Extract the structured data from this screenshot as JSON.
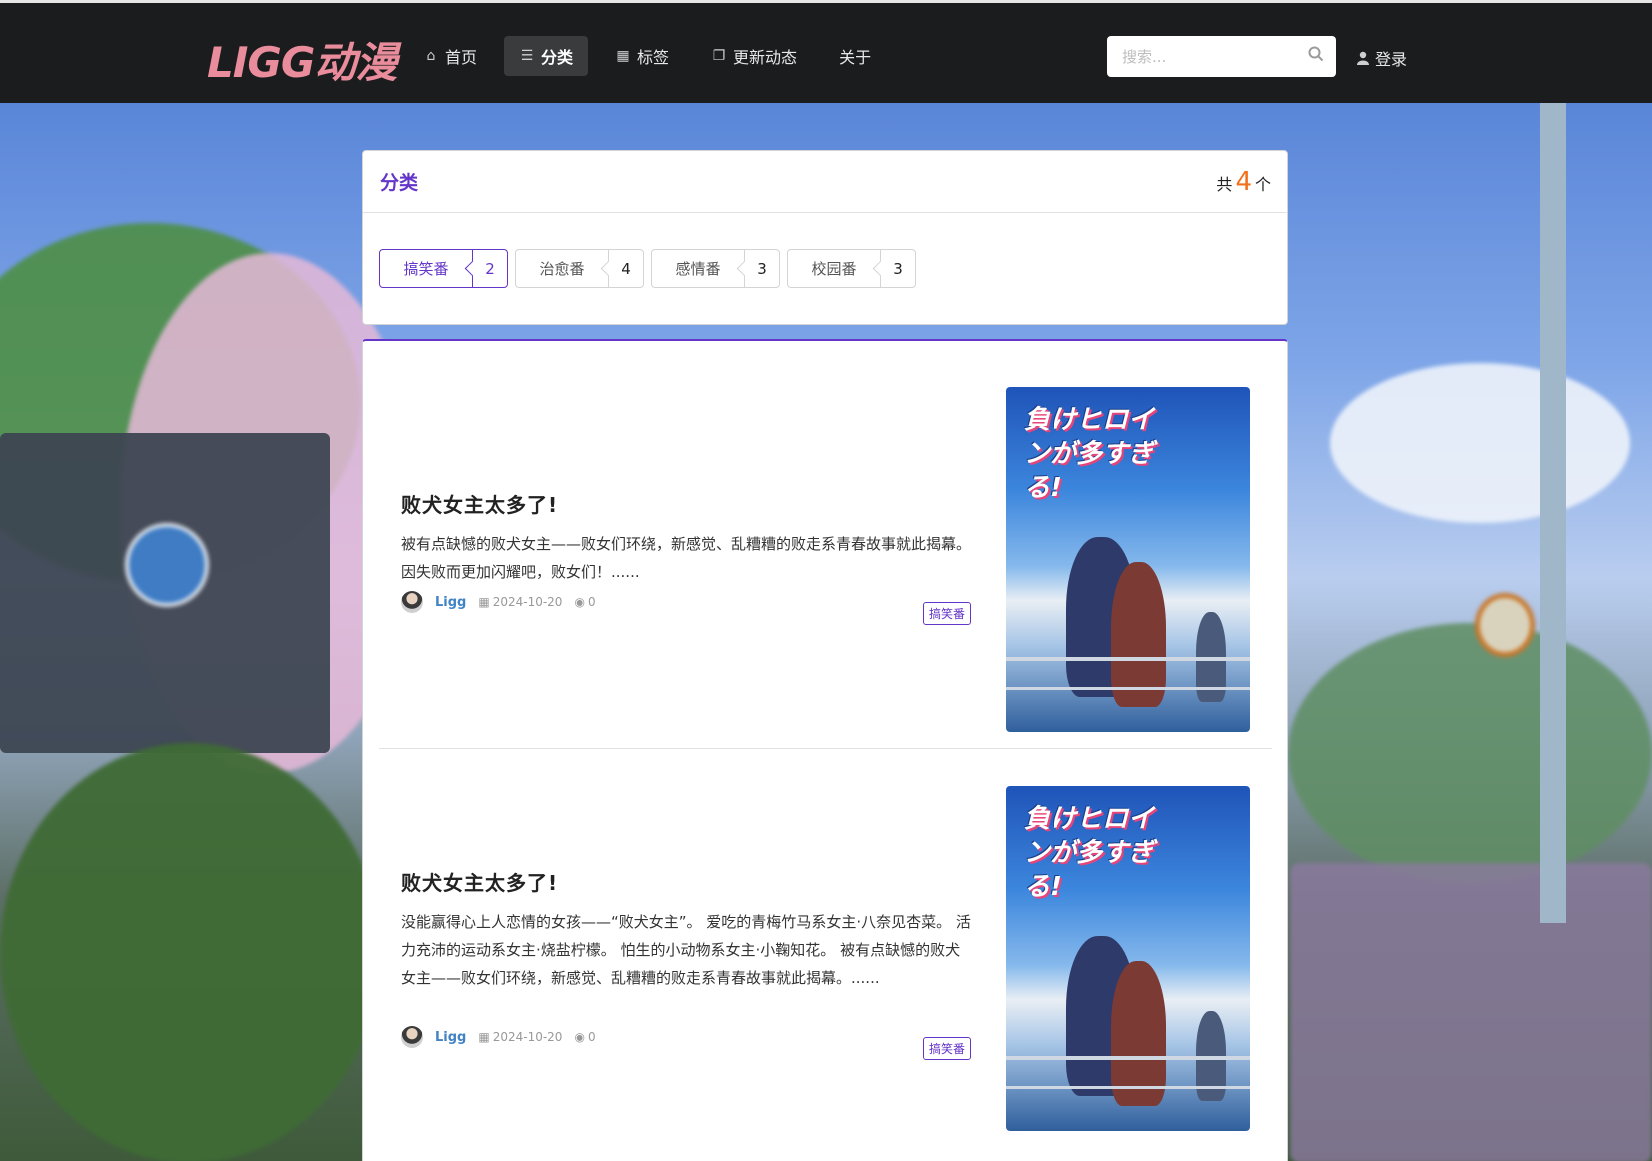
{
  "header": {
    "logo": "LIGG动漫",
    "nav": [
      {
        "label": "首页",
        "icon": "home-icon"
      },
      {
        "label": "分类",
        "icon": "list-icon"
      },
      {
        "label": "标签",
        "icon": "tag-icon"
      },
      {
        "label": "更新动态",
        "icon": "copy-icon"
      },
      {
        "label": "关于",
        "icon": ""
      }
    ],
    "active_nav": "分类",
    "search_placeholder": "搜索...",
    "login_label": "登录"
  },
  "categories": {
    "title": "分类",
    "count_prefix": "共",
    "count": "4",
    "count_suffix": "个",
    "items": [
      {
        "label": "搞笑番",
        "count": "2",
        "active": true
      },
      {
        "label": "治愈番",
        "count": "4",
        "active": false
      },
      {
        "label": "感情番",
        "count": "3",
        "active": false
      },
      {
        "label": "校园番",
        "count": "3",
        "active": false
      }
    ]
  },
  "posts": [
    {
      "title": "败犬女主太多了!",
      "description": "被有点缺憾的败犬女主——败女们环绕，新感觉、乱糟糟的败走系青春故事就此揭幕。 因失败而更加闪耀吧，败女们！......",
      "author": "Ligg",
      "date": "2024-10-20",
      "views": "0",
      "tag": "搞笑番",
      "cover_text": "負けヒロインが多すぎる!"
    },
    {
      "title": "败犬女主太多了!",
      "description": "没能赢得心上人恋情的女孩——“败犬女主”。 爱吃的青梅竹马系女主·八奈见杏菜。 活力充沛的运动系女主·烧盐柠檬。 怕生的小动物系女主·小鞠知花。 被有点缺憾的败犬女主——败女们环绕，新感觉、乱糟糟的败走系青春故事就此揭幕。......",
      "author": "Ligg",
      "date": "2024-10-20",
      "views": "0",
      "tag": "搞笑番",
      "cover_text": "負けヒロインが多すぎる!"
    }
  ],
  "colors": {
    "accent": "#6435c9",
    "count_highlight": "#f2711c",
    "topbar": "#1b1c1d",
    "logo": "#e98c9c",
    "author": "#4183c4"
  }
}
